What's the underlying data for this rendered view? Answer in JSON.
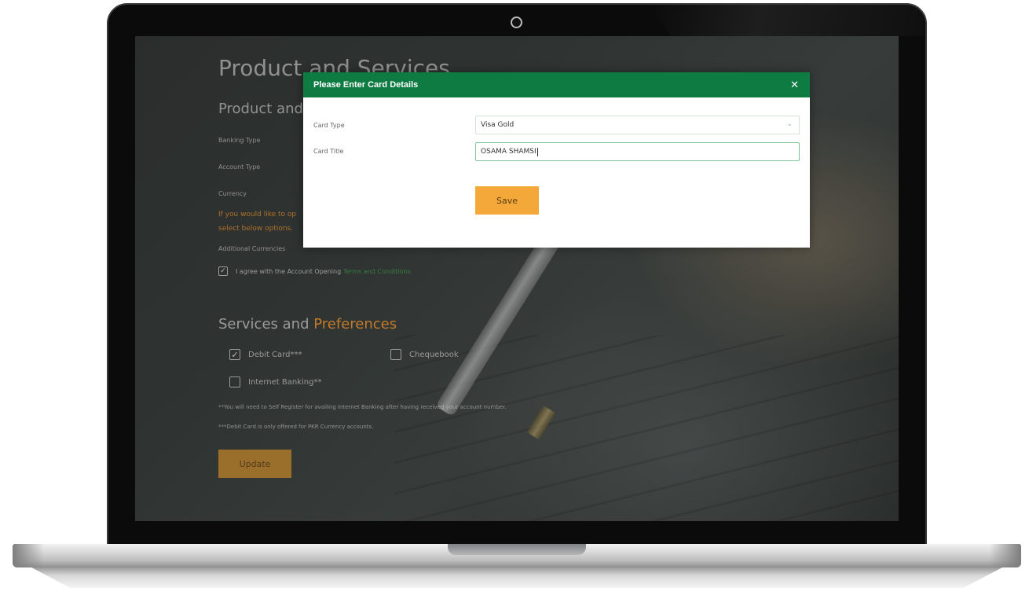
{
  "background_page": {
    "title": "Product and Services",
    "section_title": "Product and",
    "labels": {
      "banking_type": "Banking Type",
      "account_type": "Account Type",
      "currency": "Currency",
      "note_line1": "If you would like to op",
      "note_line2": "select below options.",
      "additional_currencies": "Additional Currencies"
    },
    "agree": {
      "text": "I agree with the Account Opening",
      "link": "Terms and Conditions",
      "checked": true
    },
    "services": {
      "title_prefix": "Services and",
      "title_accent": "Preferences",
      "options": [
        {
          "label": "Debit Card***",
          "checked": true
        },
        {
          "label": "Chequebook",
          "checked": false
        },
        {
          "label": "Internet Banking**",
          "checked": false
        }
      ],
      "footnote1": "**You will need to Self Register for availing Internet Banking after having received your account number.",
      "footnote2": "***Debit Card is only offered for PKR Currency accounts."
    },
    "update_label": "Update"
  },
  "modal": {
    "title": "Please Enter Card Details",
    "close_glyph": "✕",
    "card_type_label": "Card Type",
    "card_type_value": "Visa Gold",
    "card_title_label": "Card Title",
    "card_title_value": "OSAMA SHAMSI",
    "save_label": "Save"
  },
  "colors": {
    "header_green": "#0e7b43",
    "save_orange": "#f4a83a",
    "accent_orange": "#e68c28"
  }
}
